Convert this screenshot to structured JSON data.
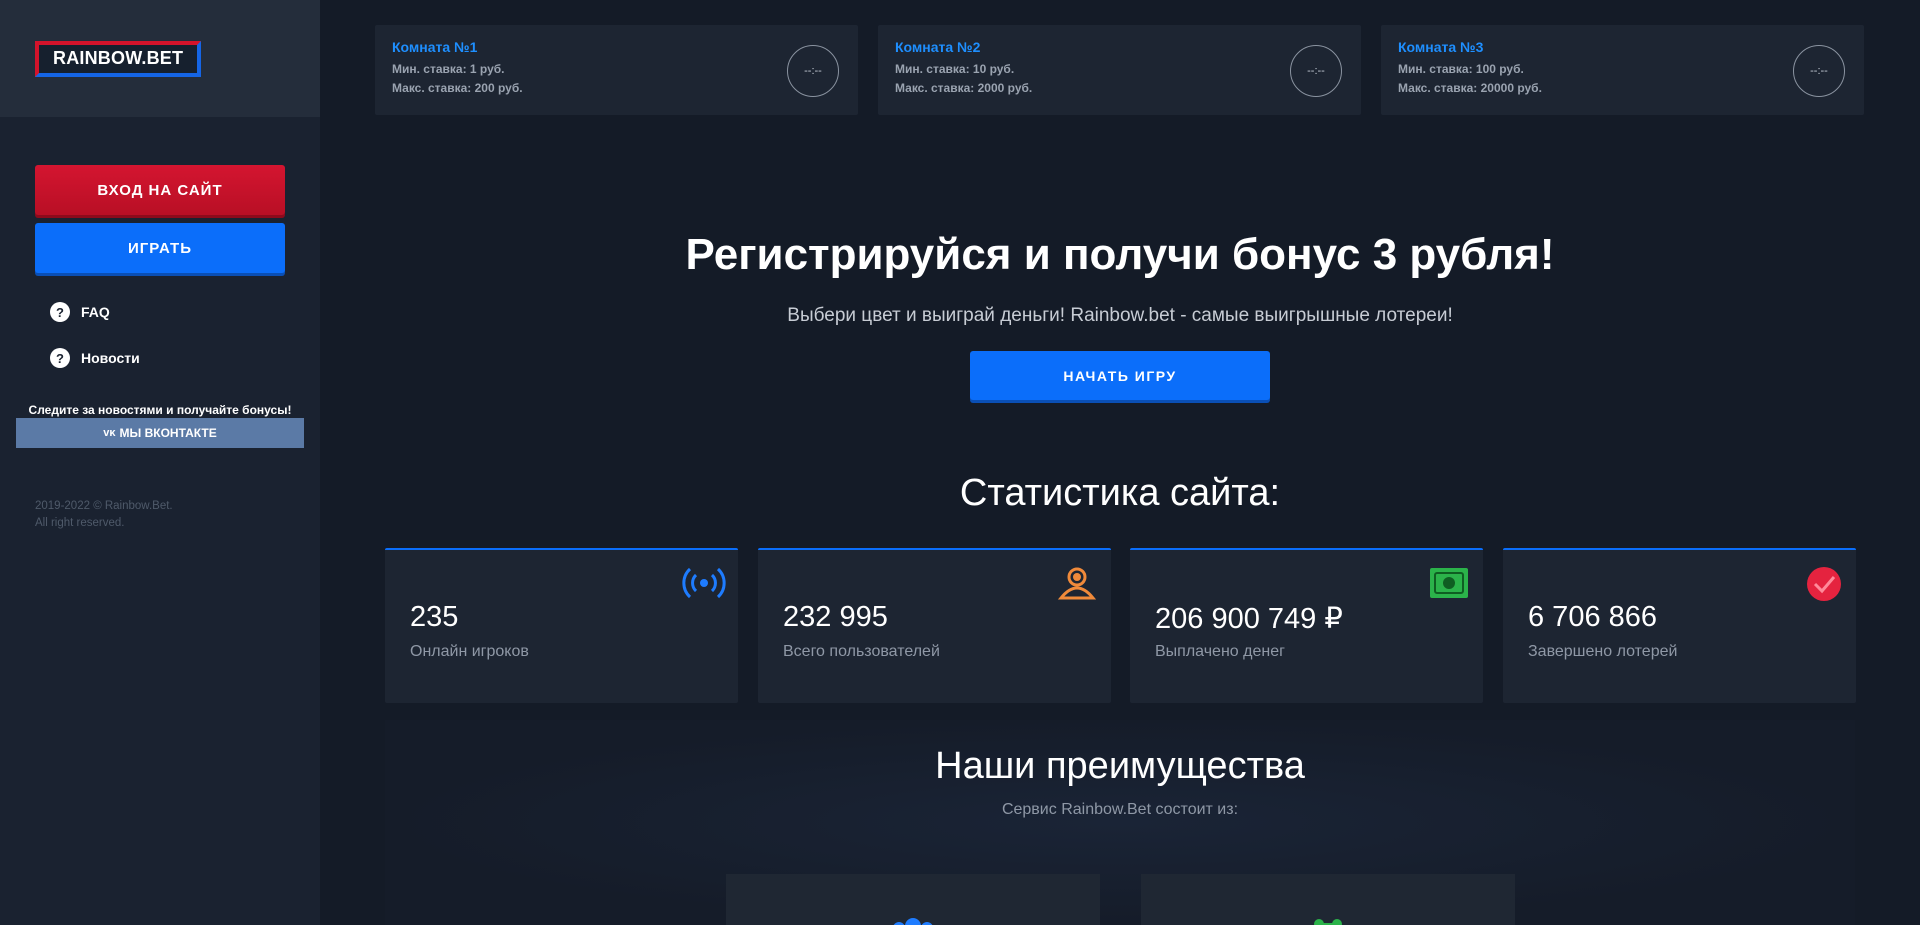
{
  "sidebar": {
    "logo": "RAINBOW.BET",
    "login_button": "ВХОД НА САЙТ",
    "play_button": "ИГРАТЬ",
    "nav": [
      {
        "label": "FAQ",
        "icon": "question-chat-icon"
      },
      {
        "label": "Новости",
        "icon": "question-chat-icon"
      }
    ],
    "follow_text": "Следите за новостями и получайте бонусы!",
    "vk_button": "МЫ ВКОНТАКТЕ",
    "vk_icon": "vk-logo-icon",
    "copyright_line1": "2019-2022 © Rainbow.Bet.",
    "copyright_line2": "All right reserved."
  },
  "rooms": [
    {
      "title": "Комната №1",
      "min": "Мин. ставка: 1 руб.",
      "max": "Макс. ставка: 200 руб.",
      "timer": "--:--"
    },
    {
      "title": "Комната №2",
      "min": "Мин. ставка: 10 руб.",
      "max": "Макс. ставка: 2000 руб.",
      "timer": "--:--"
    },
    {
      "title": "Комната №3",
      "min": "Мин. ставка: 100 руб.",
      "max": "Макс. ставка: 20000 руб.",
      "timer": "--:--"
    }
  ],
  "hero": {
    "title": "Регистрируйся и получи бонус 3 рубля!",
    "subtitle": "Выбери цвет и выиграй деньги! Rainbow.bet - самые выигрышные лотереи!",
    "start_button": "НАЧАТЬ ИГРУ"
  },
  "stats": {
    "title": "Статистика сайта:",
    "cards": [
      {
        "value": "235",
        "label": "Онлайн игроков",
        "icon": "broadcast-icon",
        "color": "#1e7cff"
      },
      {
        "value": "232 995",
        "label": "Всего пользователей",
        "icon": "users-icon",
        "color": "#f08a3a"
      },
      {
        "value": "206 900 749 ₽",
        "label": "Выплачено денег",
        "icon": "money-icon",
        "color": "#2bb34a"
      },
      {
        "value": "6 706 866",
        "label": "Завершено лотерей",
        "icon": "check-circle-icon",
        "color": "#e5233f"
      }
    ]
  },
  "advantages": {
    "title": "Наши преимущества",
    "subtitle": "Сервис Rainbow.Bet состоит из:"
  },
  "colors": {
    "accent_blue": "#0b6efa",
    "accent_red": "#d41530",
    "background": "#141b27",
    "card": "#1d2532"
  }
}
